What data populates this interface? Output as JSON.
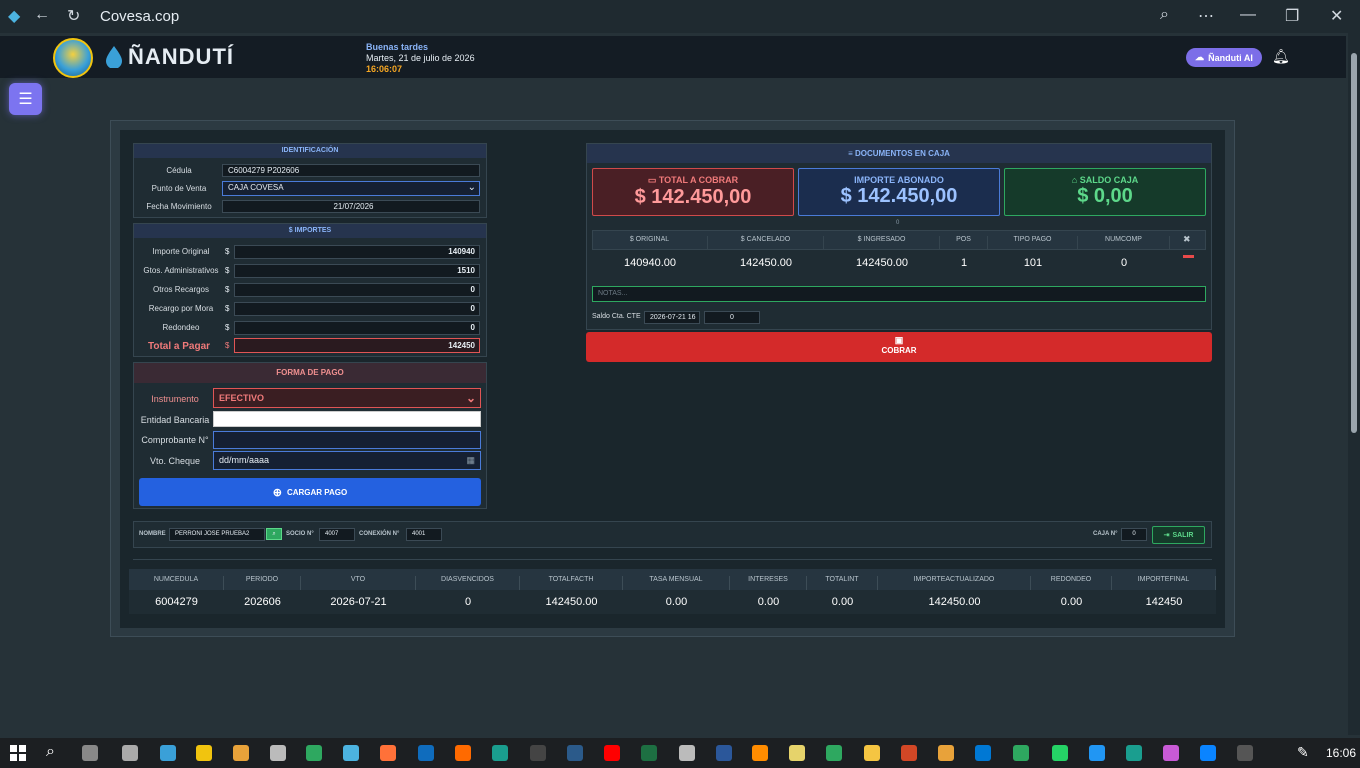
{
  "browser": {
    "title": "Covesa.cop"
  },
  "app": {
    "brand": "ÑANDUTÍ",
    "greeting": "Buenas tardes",
    "date": "Martes, 21 de julio de 2026",
    "time": "16:06:07",
    "ai_button": "Ñanduti AI"
  },
  "identificacion": {
    "title": "IDENTIFICACIÓN",
    "cedula_label": "Cédula",
    "cedula_value": "C6004279 P202606",
    "punto_label": "Punto de Venta",
    "punto_value": "CAJA COVESA",
    "fecha_label": "Fecha Movimiento",
    "fecha_value": "21/07/2026"
  },
  "importes": {
    "title": "$ IMPORTES",
    "currency": "$",
    "rows": [
      {
        "label": "Importe Original",
        "value": "140940"
      },
      {
        "label": "Gtos. Administrativos",
        "value": "1510"
      },
      {
        "label": "Otros Recargos",
        "value": "0"
      },
      {
        "label": "Recargo por Mora",
        "value": "0"
      },
      {
        "label": "Redondeo",
        "value": "0"
      }
    ],
    "total_label": "Total a Pagar",
    "total_value": "142450"
  },
  "forma_pago": {
    "title": "FORMA DE PAGO",
    "instrumento_label": "Instrumento",
    "instrumento_value": "EFECTIVO",
    "entidad_label": "Entidad Bancaria",
    "comprobante_label": "Comprobante N°",
    "vto_label": "Vto. Cheque",
    "vto_placeholder": "dd/mm/aaaa",
    "cargar_button": "CARGAR PAGO"
  },
  "documentos": {
    "title": "DOCUMENTOS EN CAJA",
    "total_cobrar_label": "TOTAL A COBRAR",
    "total_cobrar_value": "$ 142.450,00",
    "importe_abonado_label": "IMPORTE ABONADO",
    "importe_abonado_value": "$ 142.450,00",
    "saldo_caja_label": "SALDO CAJA",
    "saldo_caja_value": "$ 0,00",
    "small_zero": "0",
    "columns": [
      "$ ORIGINAL",
      "$ CANCELADO",
      "$ INGRESADO",
      "POS",
      "TIPO PAGO",
      "NUMCOMP"
    ],
    "row": [
      "140940.00",
      "142450.00",
      "142450.00",
      "1",
      "101",
      "0"
    ],
    "notas_placeholder": "NOTAS...",
    "saldo_cte_label": "Saldo Cta. CTE",
    "saldo_cte_date": "2026-07-21 16",
    "saldo_cte_value": "0",
    "cobrar_button": "COBRAR"
  },
  "socio": {
    "nombre_label": "NOMBRE",
    "nombre_value": "PERRONI JOSE PRUEBA2",
    "socio_label": "SOCIO N°",
    "socio_value": "4007",
    "conexion_label": "CONEXIÓN N°",
    "conexion_value": "4001",
    "caja_label": "CAJA N°",
    "caja_value": "0",
    "salir_button": "SALIR"
  },
  "detalle": {
    "columns": [
      "NUMCEDULA",
      "PERIODO",
      "VTO",
      "DIASVENCIDOS",
      "TOTALFACTH",
      "TASA MENSUAL",
      "INTERESES",
      "TOTALINT",
      "IMPORTEACTUALIZADO",
      "REDONDEO",
      "IMPORTEFINAL"
    ],
    "row": [
      "6004279",
      "202606",
      "2026-07-21",
      "0",
      "142450.00",
      "0.00",
      "0.00",
      "0.00",
      "142450.00",
      "0.00",
      "142450"
    ]
  },
  "taskbar": {
    "time": "16:06"
  }
}
